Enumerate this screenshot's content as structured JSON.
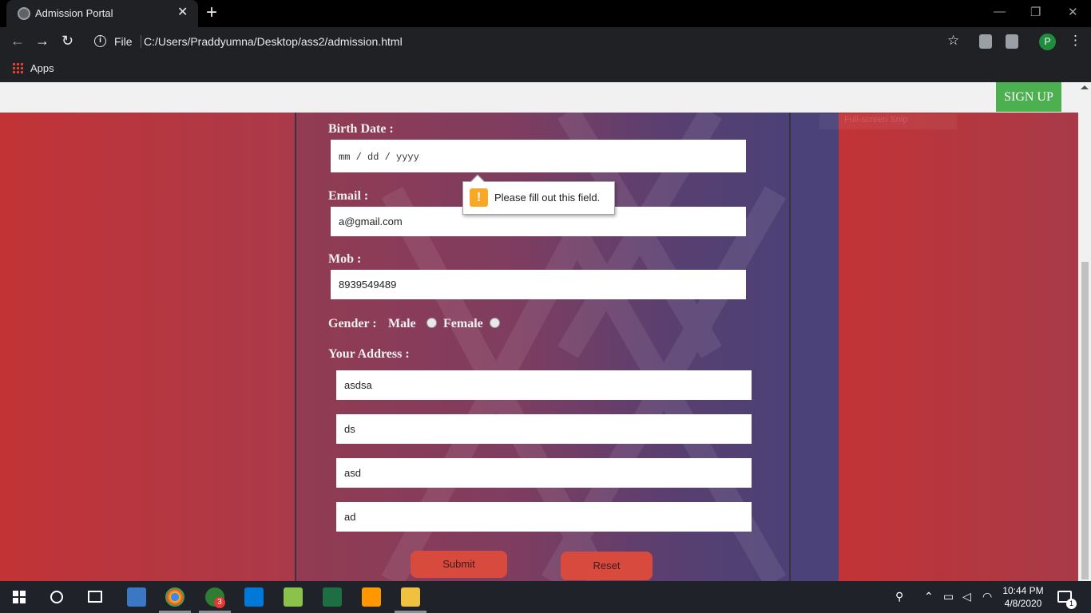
{
  "browser": {
    "tab_title": "Admission Portal",
    "tab_close": "✕",
    "new_tab": "+",
    "file_label": "File",
    "url": "C:/Users/Praddyumna/Desktop/ass2/admission.html",
    "profile_initial": "P",
    "bookmarks": {
      "apps_label": "Apps"
    }
  },
  "header": {
    "signup_label": "SIGN UP",
    "snip_text": "Full-screen Snip"
  },
  "form": {
    "birth_label": "Birth Date :",
    "birth_placeholder": "mm / dd / yyyy",
    "email_label": "Email :",
    "email_value": "a@gmail.com",
    "mob_label": "Mob :",
    "mob_value": "8939549489",
    "gender_label": "Gender :",
    "gender_options": [
      "Male",
      "Female"
    ],
    "address_label": "Your Address :",
    "address_lines": [
      "asdsa",
      "ds",
      "asd",
      "ad"
    ],
    "submit_label": "Submit",
    "reset_label": "Reset"
  },
  "validation": {
    "message": "Please fill out this field.",
    "icon": "!"
  },
  "taskbar": {
    "time": "10:44 PM",
    "date": "4/8/2020",
    "notification_count": "3",
    "action_center_count": "1"
  },
  "colors": {
    "signup_bg": "#4caf50",
    "button_bg": "#d84a3e",
    "warning": "#f9a825"
  }
}
